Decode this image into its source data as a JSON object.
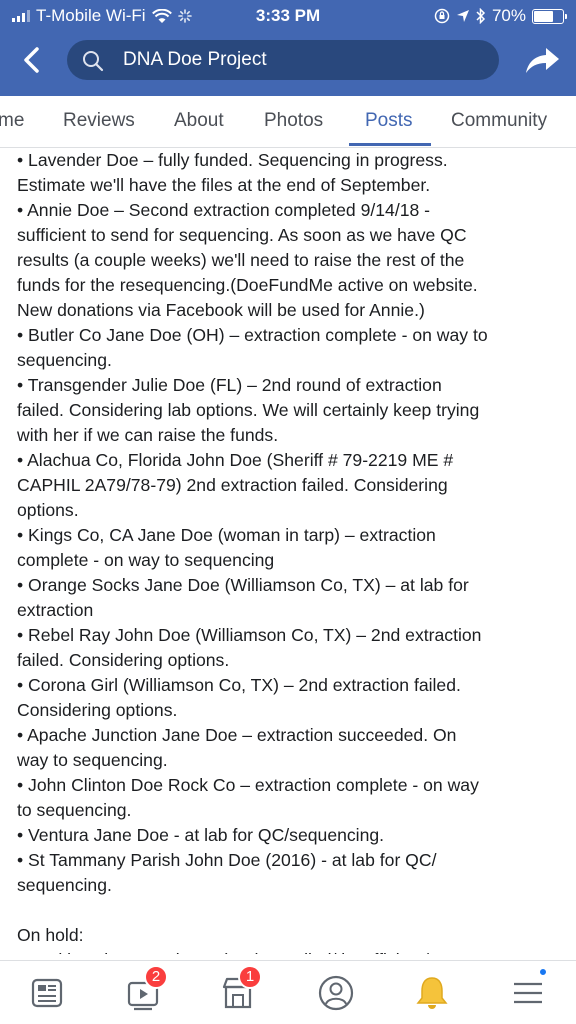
{
  "status_bar": {
    "carrier": "T-Mobile Wi-Fi",
    "time": "3:33 PM",
    "battery_percent": "70%",
    "battery_level": 0.7
  },
  "search": {
    "query": "DNA Doe Project"
  },
  "tabs": [
    {
      "label": "me"
    },
    {
      "label": "Reviews"
    },
    {
      "label": "About"
    },
    {
      "label": "Photos"
    },
    {
      "label": "Posts"
    },
    {
      "label": "Community"
    }
  ],
  "post": {
    "lines": [
      "• Lavender Doe – fully funded. Sequencing in progress.",
      "Estimate we'll have the files at the end of September.",
      "• Annie Doe – Second extraction completed 9/14/18 -",
      "sufficient to send for sequencing. As soon as we have QC",
      "results (a couple weeks) we'll need to raise the rest of the",
      "funds for the resequencing.(DoeFundMe active on website.",
      "New donations via Facebook will be used for Annie.)",
      "• Butler Co Jane Doe (OH) – extraction complete - on way to",
      "sequencing.",
      "• Transgender Julie Doe (FL) – 2nd round of extraction",
      "failed. Considering lab options. We will certainly keep trying",
      "with her if we can raise the funds.",
      "• Alachua Co, Florida John Doe (Sheriff # 79-2219 ME #",
      "CAPHIL 2A79/78-79) 2nd extraction failed. Considering",
      "options.",
      "• Kings Co, CA Jane Doe (woman in tarp) – extraction",
      "complete - on way to sequencing",
      "• Orange Socks Jane Doe (Williamson Co, TX) – at lab for",
      "extraction",
      "• Rebel Ray John Doe (Williamson Co, TX) – 2nd extraction",
      "failed. Considering options.",
      "• Corona Girl (Williamson Co, TX) – 2nd extraction failed.",
      "Considering options.",
      "• Apache Junction Jane Doe – extraction succeeded. On",
      "way to sequencing.",
      "• John Clinton Doe Rock Co – extraction complete - on way",
      "to sequencing.",
      "• Ventura Jane Doe - at lab for QC/sequencing.",
      "• St Tammany Parish John Doe (2016) - at lab for QC/",
      "sequencing.",
      "",
      "On hold:",
      "• Beckler River Road Doe (WA) – stalled/ insufficient/"
    ]
  },
  "bottom_nav": {
    "video_badge": "2",
    "marketplace_badge": "1"
  },
  "colors": {
    "brand": "#4267b2",
    "search_bg": "#29487d",
    "badge": "#fa3e3e",
    "notification_dot": "#1877f2"
  }
}
